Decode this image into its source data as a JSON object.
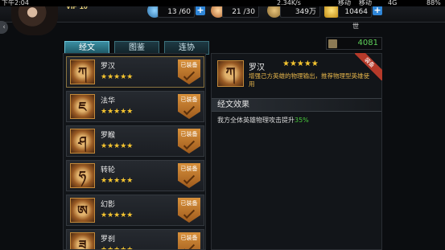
{
  "status_bar": {
    "time": "下午2:04",
    "net_speed": "2.34K/s",
    "carrier1": "移动",
    "carrier2": "移动",
    "network": "4G",
    "battery": "88%"
  },
  "header": {
    "vip": "VIP 10",
    "stamina": "13 /60",
    "energy": "21 /30",
    "coins": "349万",
    "gold": "10464"
  },
  "tabs": [
    "经文",
    "图鉴",
    "连协"
  ],
  "side_label": "世",
  "scripture_count": "4081",
  "equipped_label": "已装备",
  "list": [
    {
      "glyph": "ཀ",
      "name": "罗汉",
      "stars": "★★★★★"
    },
    {
      "glyph": "ཇ",
      "name": "法华",
      "stars": "★★★★★"
    },
    {
      "glyph": "ཤ",
      "name": "罗睺",
      "stars": "★★★★★"
    },
    {
      "glyph": "ཧ",
      "name": "转轮",
      "stars": "★★★★★"
    },
    {
      "glyph": "ཨ",
      "name": "幻影",
      "stars": "★★★★★"
    },
    {
      "glyph": "ཟ",
      "name": "罗刹",
      "stars": "★★★★★"
    }
  ],
  "detail": {
    "glyph": "ཀ",
    "name": "罗汉",
    "stars": "★★★★★",
    "description": "增强己方英雄的物理输出，推荐物理型英雄使用",
    "ribbon": "装备",
    "section_title": "经文效果",
    "effect_text": "我方全体英雄物理攻击提升",
    "effect_value": "35%"
  },
  "colors": {
    "accent_gold": "#f4c430",
    "desc_orange": "#e4b44a",
    "effect_green": "#49c93c",
    "badge_orange": "#d8913c"
  }
}
